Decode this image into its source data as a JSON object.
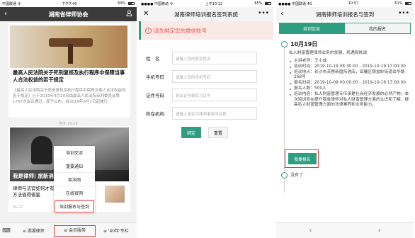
{
  "screen1": {
    "status": {
      "carrier": "中国联通 令",
      "time": "下午7:40",
      "battery": "69% "
    },
    "title": "湖南省律师协会",
    "news1": {
      "title": "最高人民法院关于死刑复核及执行程序中保障当事人合法权益的若干规定",
      "body": "《最高人民法院关于死刑复核及执行程序中保障当事人合法权益的若干规定》已于2019年4月29日由最高人民法院审判委员会第1767次会议通过，现予公布，自2019年9月1日起施行。"
    },
    "timestamp": "昨天 19:19",
    "news2": {
      "caption": "我是律师| 旅新消息",
      "title": "律师与法官如何才有良性互动？这些方法值得借鉴",
      "date": "05-27"
    },
    "menu": [
      "培训交流",
      "重要通知",
      "如法网",
      "在线官网",
      "培训报名与签到"
    ],
    "tabbar": [
      "湖湘律师",
      "会员服务",
      "'40年'专栏"
    ]
  },
  "screen2": {
    "status": {
      "carrier": "●●●● 中国移动 令",
      "time": "上午10:12",
      "battery": "85% "
    },
    "title": "湖南律师培训报名签到系统",
    "warning": "请先绑定您的微信账号",
    "fields": [
      {
        "label": "姓　名",
        "placeholder": "请输入您的真实姓名"
      },
      {
        "label": "手机号码",
        "placeholder": "请输入您的手机号码"
      },
      {
        "label": "证件号码",
        "placeholder": "执业证号或实习证号"
      },
      {
        "label": "所在机构",
        "placeholder": "请输入或实习律师事务所名称"
      }
    ],
    "submit": "绑定",
    "reset": "重置"
  },
  "screen3": {
    "status": {
      "carrier": "●●●● 中国联通 4G",
      "time": "10:57",
      "battery": "61% "
    },
    "title": "湖南律师培训报名与签到",
    "tabs": [
      "培训信息",
      "我的报名"
    ],
    "event": {
      "date": "10月19日",
      "intro": "私人财富管理律师业务的发展、机遇和挑战",
      "bullets": [
        "主讲老师：王小成",
        "培训时间：2019-10-19 08:30:00 - 2019-10-19 17:00:00",
        "培训地点：长沙市芙蓉新国际酒店，岳麓区银盆岭街道岳华路268号",
        "报名时间：2019-10-09 00:00:00 - 2019-10-16 17:00:00",
        "报名人数：500人",
        "培训内容：私人财富管理专传承是社会经济发展的必然产物。本次培训旨在提升我省律师对私人财富管理方面的认识和了解，提高私人财富管理方面的法律素养和业务能力。"
      ],
      "register": "我要报名"
    },
    "nomore": "没有了"
  }
}
